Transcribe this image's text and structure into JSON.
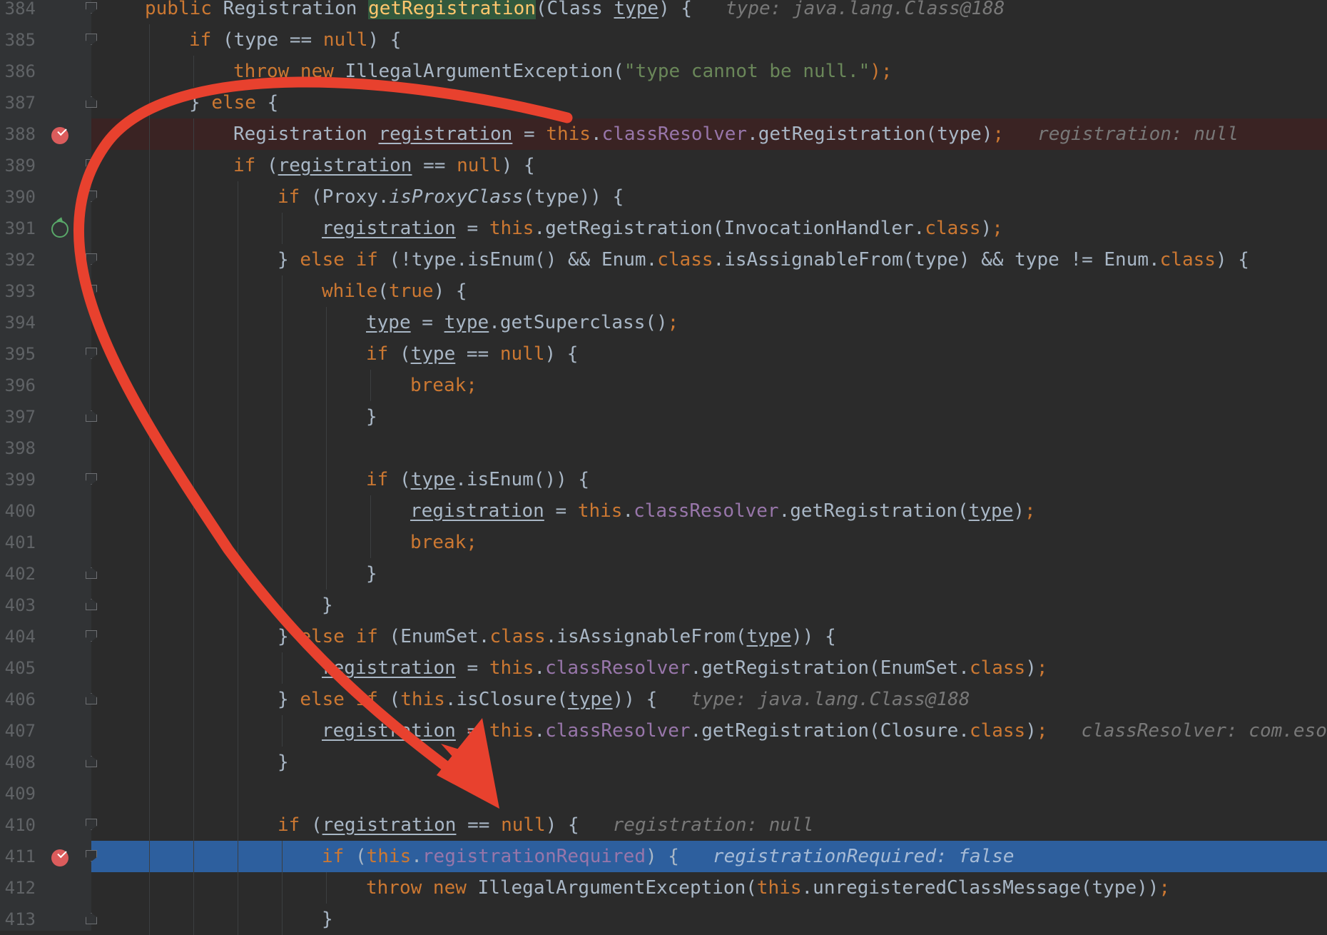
{
  "window": {
    "title": ""
  },
  "colors": {
    "background": "#2b2b2b",
    "gutter": "#313335",
    "keyword": "#cc7832",
    "string": "#6a8759",
    "field": "#9876aa",
    "default": "#a9b7c6",
    "method_highlight": "#ffc66d",
    "current_line": "#2d5f9e",
    "breakpoint_line": "#3a2323",
    "annotation_arrow": "#e8412e"
  },
  "breakpoints": [
    {
      "line": "388",
      "type": "breakpoint-checked-icon"
    },
    {
      "line": "391",
      "type": "breakpoint-run-to-cursor-icon"
    },
    {
      "line": "411",
      "type": "breakpoint-checked-icon"
    }
  ],
  "current_line": "411",
  "lines": [
    {
      "n": "384",
      "indent": 0,
      "fold": "down",
      "tokens": [
        {
          "t": "public ",
          "c": "kw"
        },
        {
          "t": "Registration "
        },
        {
          "t": "getRegistration",
          "c": "hl"
        },
        {
          "t": "(Class "
        },
        {
          "t": "type",
          "c": "ul"
        },
        {
          "t": ") {"
        },
        {
          "t": "   type: java.lang.Class@188",
          "c": "hint"
        }
      ]
    },
    {
      "n": "385",
      "indent": 1,
      "fold": "down",
      "tokens": [
        {
          "t": "if ",
          "c": "kw"
        },
        {
          "t": "(type == "
        },
        {
          "t": "null",
          "c": "kw"
        },
        {
          "t": ") {"
        }
      ]
    },
    {
      "n": "386",
      "indent": 2,
      "tokens": [
        {
          "t": "throw new ",
          "c": "kw"
        },
        {
          "t": "IllegalArgumentException("
        },
        {
          "t": "\"type cannot be null.\"",
          "c": "str"
        },
        {
          "t": ");",
          "c": "kw"
        }
      ]
    },
    {
      "n": "387",
      "indent": 1,
      "fold": "up",
      "tokens": [
        {
          "t": "} "
        },
        {
          "t": "else ",
          "c": "kw"
        },
        {
          "t": "{"
        }
      ]
    },
    {
      "n": "388",
      "indent": 2,
      "bp": "check",
      "bgline": true,
      "tokens": [
        {
          "t": "Registration "
        },
        {
          "t": "registration",
          "c": "ul"
        },
        {
          "t": " = "
        },
        {
          "t": "this",
          "c": "kw"
        },
        {
          "t": "."
        },
        {
          "t": "classResolver",
          "c": "fld"
        },
        {
          "t": ".getRegistration(type)"
        },
        {
          "t": ";",
          "c": "kw"
        },
        {
          "t": "   registration: null",
          "c": "hint"
        }
      ]
    },
    {
      "n": "389",
      "indent": 2,
      "fold": "down",
      "tokens": [
        {
          "t": "if ",
          "c": "kw"
        },
        {
          "t": "("
        },
        {
          "t": "registration",
          "c": "ul"
        },
        {
          "t": " == "
        },
        {
          "t": "null",
          "c": "kw"
        },
        {
          "t": ") {"
        }
      ]
    },
    {
      "n": "390",
      "indent": 3,
      "fold": "down",
      "tokens": [
        {
          "t": "if ",
          "c": "kw"
        },
        {
          "t": "(Proxy."
        },
        {
          "t": "isProxyClass",
          "c": "ital"
        },
        {
          "t": "(type)) {"
        }
      ]
    },
    {
      "n": "391",
      "indent": 4,
      "bp": "ring",
      "tokens": [
        {
          "t": "registration",
          "c": "ul"
        },
        {
          "t": " = "
        },
        {
          "t": "this",
          "c": "kw"
        },
        {
          "t": ".getRegistration(InvocationHandler."
        },
        {
          "t": "class",
          "c": "kw"
        },
        {
          "t": ")"
        },
        {
          "t": ";",
          "c": "kw"
        }
      ]
    },
    {
      "n": "392",
      "indent": 3,
      "fold": "down",
      "tokens": [
        {
          "t": "} "
        },
        {
          "t": "else if ",
          "c": "kw"
        },
        {
          "t": "(!type.isEnum() && Enum."
        },
        {
          "t": "class",
          "c": "kw"
        },
        {
          "t": ".isAssignableFrom(type) && type != Enum."
        },
        {
          "t": "class",
          "c": "kw"
        },
        {
          "t": ") {"
        }
      ]
    },
    {
      "n": "393",
      "indent": 4,
      "fold": "down",
      "tokens": [
        {
          "t": "while",
          "c": "kw"
        },
        {
          "t": "("
        },
        {
          "t": "true",
          "c": "kw"
        },
        {
          "t": ") {"
        }
      ]
    },
    {
      "n": "394",
      "indent": 5,
      "tokens": [
        {
          "t": "type",
          "c": "ul"
        },
        {
          "t": " = "
        },
        {
          "t": "type",
          "c": "ul"
        },
        {
          "t": ".getSuperclass()"
        },
        {
          "t": ";",
          "c": "kw"
        }
      ]
    },
    {
      "n": "395",
      "indent": 5,
      "fold": "down",
      "tokens": [
        {
          "t": "if ",
          "c": "kw"
        },
        {
          "t": "("
        },
        {
          "t": "type",
          "c": "ul"
        },
        {
          "t": " == "
        },
        {
          "t": "null",
          "c": "kw"
        },
        {
          "t": ") {"
        }
      ]
    },
    {
      "n": "396",
      "indent": 6,
      "tokens": [
        {
          "t": "break;",
          "c": "kw"
        }
      ]
    },
    {
      "n": "397",
      "indent": 5,
      "fold": "up",
      "tokens": [
        {
          "t": "}"
        }
      ]
    },
    {
      "n": "398",
      "indent": 5,
      "tokens": []
    },
    {
      "n": "399",
      "indent": 5,
      "fold": "down",
      "tokens": [
        {
          "t": "if ",
          "c": "kw"
        },
        {
          "t": "("
        },
        {
          "t": "type",
          "c": "ul"
        },
        {
          "t": ".isEnum()) {"
        }
      ]
    },
    {
      "n": "400",
      "indent": 6,
      "tokens": [
        {
          "t": "registration",
          "c": "ul"
        },
        {
          "t": " = "
        },
        {
          "t": "this",
          "c": "kw"
        },
        {
          "t": "."
        },
        {
          "t": "classResolver",
          "c": "fld"
        },
        {
          "t": ".getRegistration("
        },
        {
          "t": "type",
          "c": "ul"
        },
        {
          "t": ")"
        },
        {
          "t": ";",
          "c": "kw"
        }
      ]
    },
    {
      "n": "401",
      "indent": 6,
      "tokens": [
        {
          "t": "break;",
          "c": "kw"
        }
      ]
    },
    {
      "n": "402",
      "indent": 5,
      "fold": "up",
      "tokens": [
        {
          "t": "}"
        }
      ]
    },
    {
      "n": "403",
      "indent": 4,
      "fold": "up",
      "tokens": [
        {
          "t": "}"
        }
      ]
    },
    {
      "n": "404",
      "indent": 3,
      "fold": "down",
      "tokens": [
        {
          "t": "} "
        },
        {
          "t": "else if ",
          "c": "kw"
        },
        {
          "t": "(EnumSet."
        },
        {
          "t": "class",
          "c": "kw"
        },
        {
          "t": ".isAssignableFrom("
        },
        {
          "t": "type",
          "c": "ul"
        },
        {
          "t": ")) {"
        }
      ]
    },
    {
      "n": "405",
      "indent": 4,
      "tokens": [
        {
          "t": "registration",
          "c": "ul"
        },
        {
          "t": " = "
        },
        {
          "t": "this",
          "c": "kw"
        },
        {
          "t": "."
        },
        {
          "t": "classResolver",
          "c": "fld"
        },
        {
          "t": ".getRegistration(EnumSet."
        },
        {
          "t": "class",
          "c": "kw"
        },
        {
          "t": ")"
        },
        {
          "t": ";",
          "c": "kw"
        }
      ]
    },
    {
      "n": "406",
      "indent": 3,
      "fold": "up",
      "tokens": [
        {
          "t": "} "
        },
        {
          "t": "else if ",
          "c": "kw"
        },
        {
          "t": "("
        },
        {
          "t": "this",
          "c": "kw"
        },
        {
          "t": ".isClosure("
        },
        {
          "t": "type",
          "c": "ul"
        },
        {
          "t": ")) {"
        },
        {
          "t": "   type: java.lang.Class@188",
          "c": "hint"
        }
      ]
    },
    {
      "n": "407",
      "indent": 4,
      "tokens": [
        {
          "t": "registration",
          "c": "ul"
        },
        {
          "t": " = "
        },
        {
          "t": "this",
          "c": "kw"
        },
        {
          "t": "."
        },
        {
          "t": "classResolver",
          "c": "fld"
        },
        {
          "t": ".getRegistration(Closure."
        },
        {
          "t": "class",
          "c": "kw"
        },
        {
          "t": ")"
        },
        {
          "t": ";",
          "c": "kw"
        },
        {
          "t": "   classResolver: com.esot",
          "c": "hint"
        }
      ]
    },
    {
      "n": "408",
      "indent": 3,
      "fold": "up",
      "tokens": [
        {
          "t": "}"
        }
      ]
    },
    {
      "n": "409",
      "indent": 3,
      "tokens": []
    },
    {
      "n": "410",
      "indent": 3,
      "fold": "down",
      "tokens": [
        {
          "t": "if ",
          "c": "kw"
        },
        {
          "t": "("
        },
        {
          "t": "registration",
          "c": "ul"
        },
        {
          "t": " == "
        },
        {
          "t": "null",
          "c": "kw"
        },
        {
          "t": ") {"
        },
        {
          "t": "   registration: null",
          "c": "hint"
        }
      ]
    },
    {
      "n": "411",
      "indent": 4,
      "bp": "check",
      "current": true,
      "fold": "down",
      "tokens": [
        {
          "t": "if ",
          "c": "kw"
        },
        {
          "t": "("
        },
        {
          "t": "this",
          "c": "kw"
        },
        {
          "t": "."
        },
        {
          "t": "registrationRequired",
          "c": "fld"
        },
        {
          "t": ") {"
        },
        {
          "t": "   registrationRequired: false",
          "c": "hint"
        }
      ]
    },
    {
      "n": "412",
      "indent": 5,
      "tokens": [
        {
          "t": "throw new ",
          "c": "kw"
        },
        {
          "t": "IllegalArgumentException("
        },
        {
          "t": "this",
          "c": "kw"
        },
        {
          "t": ".unregisteredClassMessage(type))"
        },
        {
          "t": ";",
          "c": "kw"
        }
      ]
    },
    {
      "n": "413",
      "indent": 4,
      "fold": "up",
      "tokens": [
        {
          "t": "}"
        }
      ]
    }
  ]
}
